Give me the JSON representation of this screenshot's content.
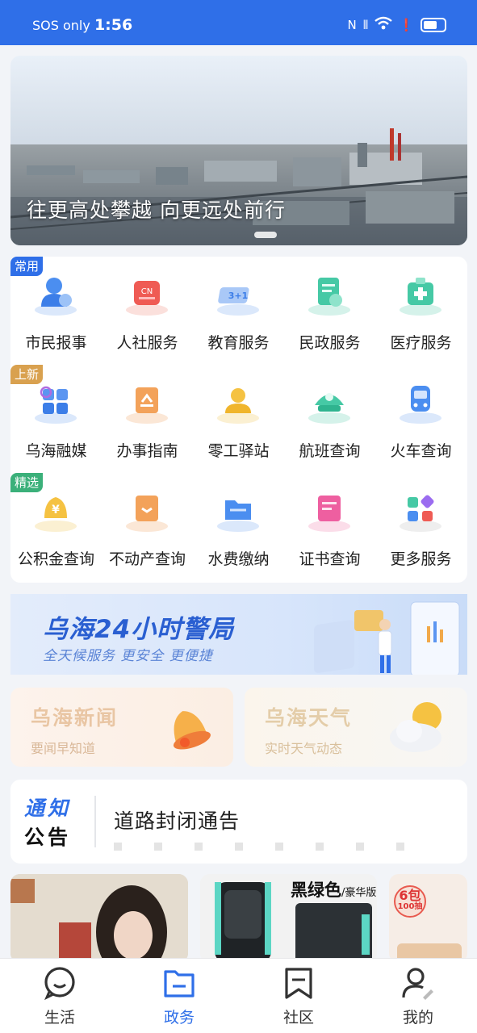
{
  "status_bar": {
    "carrier": "SOS only",
    "time": "1:56",
    "nfc": "N",
    "wifi_label": "6"
  },
  "banner": {
    "caption": "往更高处攀越 向更远处前行"
  },
  "services": {
    "rows": [
      {
        "tag": "常用",
        "tag_color": "#2f6fe8",
        "items": [
          {
            "label": "市民报事",
            "icon": "citizen-report-icon"
          },
          {
            "label": "人社服务",
            "icon": "social-service-icon",
            "icon_text": "CN"
          },
          {
            "label": "教育服务",
            "icon": "education-icon",
            "icon_text": "3+1"
          },
          {
            "label": "民政服务",
            "icon": "civil-affairs-icon"
          },
          {
            "label": "医疗服务",
            "icon": "medical-icon"
          }
        ]
      },
      {
        "tag": "上新",
        "tag_color": "#d9a14f",
        "items": [
          {
            "label": "乌海融媒",
            "icon": "media-icon"
          },
          {
            "label": "办事指南",
            "icon": "guide-icon"
          },
          {
            "label": "零工驿站",
            "icon": "gig-station-icon"
          },
          {
            "label": "航班查询",
            "icon": "flight-icon"
          },
          {
            "label": "火车查询",
            "icon": "train-icon"
          }
        ]
      },
      {
        "tag": "精选",
        "tag_color": "#3bb07a",
        "items": [
          {
            "label": "公积金查询",
            "icon": "housing-fund-icon",
            "icon_text": "¥"
          },
          {
            "label": "不动产查询",
            "icon": "real-estate-icon"
          },
          {
            "label": "水费缴纳",
            "icon": "water-bill-icon"
          },
          {
            "label": "证书查询",
            "icon": "certificate-icon"
          },
          {
            "label": "更多服务",
            "icon": "more-services-icon"
          }
        ]
      }
    ]
  },
  "police_banner": {
    "title": "乌海24小时警局",
    "subtitle": "全天候服务 更安全 更便捷"
  },
  "info_cards": {
    "news": {
      "title": "乌海新闻",
      "subtitle": "要闻早知道"
    },
    "weather": {
      "title": "乌海天气",
      "subtitle": "实时天气动态"
    }
  },
  "notice": {
    "logo_line1": "通知",
    "logo_line2": "公告",
    "text": "道路封闭通告"
  },
  "ads": {
    "ad2_caption": "黑绿色",
    "ad2_caption_small": "/豪华版",
    "ad3_badge_main": "6包",
    "ad3_badge_sub": "100抽"
  },
  "tabs": [
    {
      "label": "生活",
      "icon": "chat-face-icon",
      "active": false
    },
    {
      "label": "政务",
      "icon": "folder-icon",
      "active": true
    },
    {
      "label": "社区",
      "icon": "bookmark-icon",
      "active": false
    },
    {
      "label": "我的",
      "icon": "user-edit-icon",
      "active": false
    }
  ],
  "colors": {
    "accent": "#2f6fe8",
    "tab_inactive": "#333333"
  }
}
